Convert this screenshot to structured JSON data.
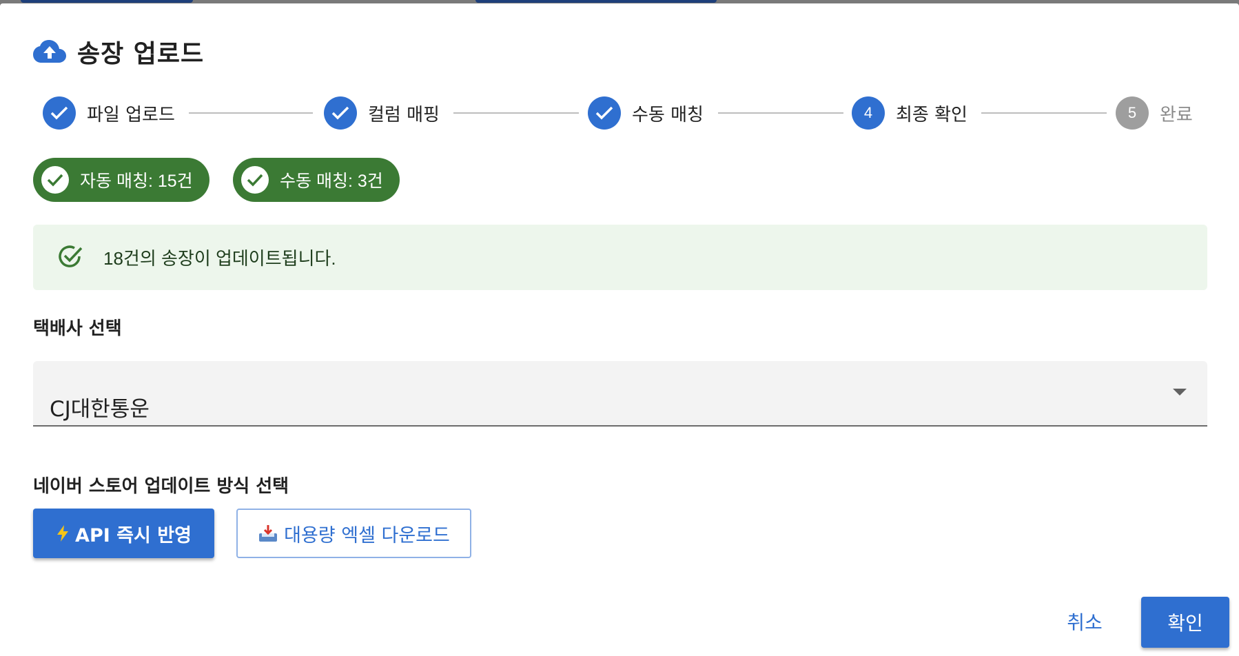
{
  "dialog": {
    "title": "송장 업로드",
    "title_icon": "cloud-upload-icon"
  },
  "stepper": {
    "steps": [
      {
        "label": "파일 업로드",
        "state": "completed",
        "number": ""
      },
      {
        "label": "컬럼 매핑",
        "state": "completed",
        "number": ""
      },
      {
        "label": "수동 매칭",
        "state": "completed",
        "number": ""
      },
      {
        "label": "최종 확인",
        "state": "active",
        "number": "4"
      },
      {
        "label": "완료",
        "state": "pending",
        "number": "5"
      }
    ]
  },
  "chips": {
    "auto_match": "자동 매칭: 15건",
    "manual_match": "수동 매칭: 3건"
  },
  "alert": {
    "message": "18건의 송장이 업데이트됩니다."
  },
  "courier": {
    "label": "택배사 선택",
    "value": "CJ대한통운"
  },
  "update_method": {
    "label": "네이버 스토어 업데이트 방식 선택",
    "api_button": "API 즉시 반영",
    "excel_button": "대용량 엑셀 다운로드"
  },
  "actions": {
    "cancel": "취소",
    "confirm": "확인"
  },
  "colors": {
    "primary": "#2f6fd0",
    "success": "#3b7a34",
    "alert_bg": "#edf6ec",
    "inactive": "#9e9e9e"
  }
}
